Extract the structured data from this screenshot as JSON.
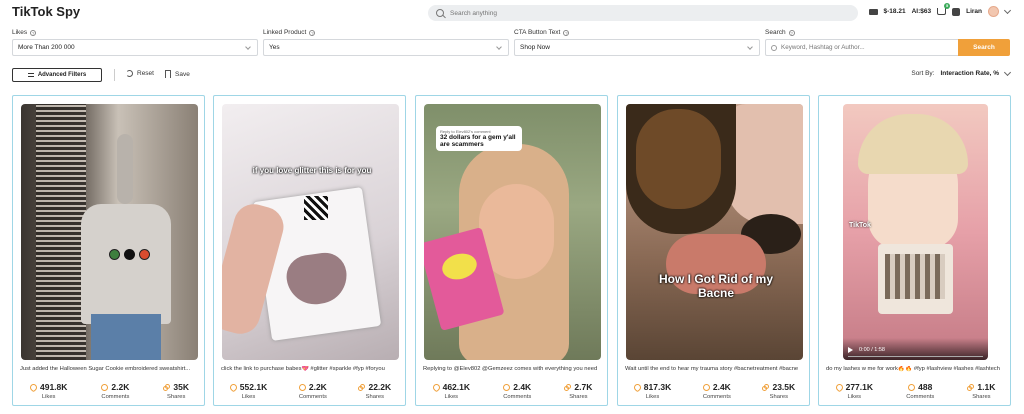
{
  "app": {
    "title": "TikTok Spy"
  },
  "header": {
    "search_placeholder": "Search anything",
    "balance": "$-18.21",
    "ai_credits": "AI:$63",
    "cart_badge": "5",
    "user_name": "Liran"
  },
  "filters": {
    "likes": {
      "label": "Likes",
      "value": "More Than 200 000"
    },
    "linked_product": {
      "label": "Linked Product",
      "value": "Yes"
    },
    "cta": {
      "label": "CTA Button Text",
      "value": "Shop Now"
    },
    "search": {
      "label": "Search",
      "placeholder": "Keyword, Hashtag or Author...",
      "button": "Search"
    }
  },
  "toolbar": {
    "advanced_filters": "Advanced Filters",
    "reset": "Reset",
    "save": "Save",
    "sort_label": "Sort By:",
    "sort_value": "Interaction Rate, %"
  },
  "labels": {
    "likes": "Likes",
    "comments": "Comments",
    "shares": "Shares"
  },
  "cards": [
    {
      "caption": "Just added the Halloween Sugar Cookie embroidered sweatshirt...",
      "likes": "491.8K",
      "comments": "2.2K",
      "shares": "35K",
      "colors": {
        "bg": "#8a8075",
        "accent": "#cfc9c2"
      }
    },
    {
      "caption": "click the link to purchase babes💖 #glitter #sparkle #fyp #foryou",
      "likes": "552.1K",
      "comments": "2.2K",
      "shares": "22.2K",
      "overlay": "if you love glitter this is for you",
      "colors": {
        "bg": "#e8e4e6",
        "accent": "#b8a8ae"
      }
    },
    {
      "caption": "Replying to @Elev802 @Gemzeez comes with everything you need",
      "likes": "462.1K",
      "comments": "2.4K",
      "shares": "2.7K",
      "bubble_small": "Reply to Elev802's comment",
      "bubble_text": "32 dollars for a gem y'all are scammers",
      "colors": {
        "bg": "#8a9a70",
        "accent": "#e6a98c"
      }
    },
    {
      "caption": "Wait until the end to hear my trauma story #bacnetreatment #bacne",
      "likes": "817.3K",
      "comments": "2.4K",
      "shares": "23.5K",
      "overlay": "How I Got Rid of my Bacne",
      "colors": {
        "bg": "#7a6250",
        "accent": "#d8b8a8"
      }
    },
    {
      "caption": "do my lashes w me for work🔥🔥 #fyp #lashview #lashes #lashtech",
      "likes": "277.1K",
      "comments": "488",
      "shares": "1.1K",
      "tiktok_mark": "TikTok",
      "video_time": "0:00 / 1:58",
      "colors": {
        "bg": "#e6a0a8",
        "accent": "#f2d0c8"
      }
    }
  ]
}
